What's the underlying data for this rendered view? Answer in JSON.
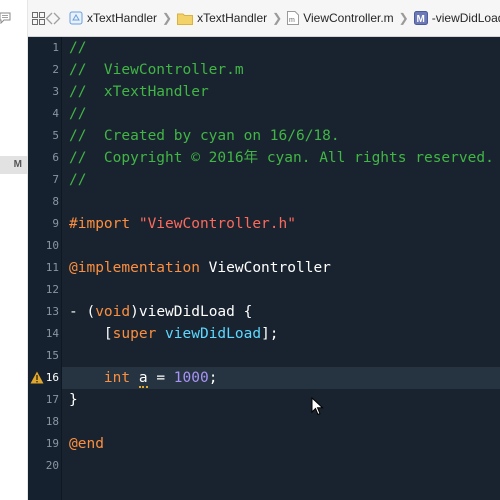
{
  "jumpbar": {
    "crumbs": [
      {
        "icon": "project-icon",
        "label": "xTextHandler"
      },
      {
        "icon": "folder-icon",
        "label": "xTextHandler"
      },
      {
        "icon": "m-file-icon",
        "label": "ViewController.m"
      },
      {
        "icon": "method-icon",
        "label": "-viewDidLoad"
      }
    ]
  },
  "sidebar": {
    "badge": "M"
  },
  "editor": {
    "lines": [
      {
        "n": "1",
        "tokens": [
          {
            "t": "//",
            "c": "comment"
          }
        ]
      },
      {
        "n": "2",
        "tokens": [
          {
            "t": "//  ViewController.m",
            "c": "comment"
          }
        ]
      },
      {
        "n": "3",
        "tokens": [
          {
            "t": "//  xTextHandler",
            "c": "comment"
          }
        ]
      },
      {
        "n": "4",
        "tokens": [
          {
            "t": "//",
            "c": "comment"
          }
        ]
      },
      {
        "n": "5",
        "tokens": [
          {
            "t": "//  Created by cyan on 16/6/18.",
            "c": "comment"
          }
        ]
      },
      {
        "n": "6",
        "tokens": [
          {
            "t": "//  Copyright © 2016年 cyan. All rights reserved.",
            "c": "comment"
          }
        ]
      },
      {
        "n": "7",
        "tokens": [
          {
            "t": "//",
            "c": "comment"
          }
        ]
      },
      {
        "n": "8",
        "tokens": []
      },
      {
        "n": "9",
        "tokens": [
          {
            "t": "#import ",
            "c": "pre"
          },
          {
            "t": "\"ViewController.h\"",
            "c": "str"
          }
        ]
      },
      {
        "n": "10",
        "tokens": []
      },
      {
        "n": "11",
        "tokens": [
          {
            "t": "@implementation",
            "c": "key"
          },
          {
            "t": " ViewController",
            "c": "plain"
          }
        ]
      },
      {
        "n": "12",
        "tokens": []
      },
      {
        "n": "13",
        "tokens": [
          {
            "t": "- (",
            "c": "plain"
          },
          {
            "t": "void",
            "c": "key"
          },
          {
            "t": ")viewDidLoad {",
            "c": "plain"
          }
        ]
      },
      {
        "n": "14",
        "tokens": [
          {
            "t": "    [",
            "c": "plain"
          },
          {
            "t": "super",
            "c": "key"
          },
          {
            "t": " ",
            "c": "plain"
          },
          {
            "t": "viewDidLoad",
            "c": "meth"
          },
          {
            "t": "];",
            "c": "plain"
          }
        ]
      },
      {
        "n": "15",
        "tokens": []
      },
      {
        "n": "16",
        "tokens": [
          {
            "t": "    ",
            "c": "plain"
          },
          {
            "t": "int",
            "c": "key"
          },
          {
            "t": " ",
            "c": "plain"
          },
          {
            "t": "a",
            "c": "plain",
            "warn": true
          },
          {
            "t": " = ",
            "c": "plain"
          },
          {
            "t": "1000",
            "c": "num"
          },
          {
            "t": ";",
            "c": "plain"
          }
        ],
        "current": true,
        "warning": true
      },
      {
        "n": "17",
        "tokens": [
          {
            "t": "}",
            "c": "plain"
          }
        ]
      },
      {
        "n": "18",
        "tokens": []
      },
      {
        "n": "19",
        "tokens": [
          {
            "t": "@end",
            "c": "key"
          }
        ]
      },
      {
        "n": "20",
        "tokens": []
      }
    ]
  },
  "colors": {
    "background": "#19232f",
    "comment": "#41b645",
    "keyword": "#fc8f3f",
    "string": "#fc6a5d",
    "method": "#5dd8ff",
    "number": "#a794f6",
    "warning": "#e0a72e"
  }
}
